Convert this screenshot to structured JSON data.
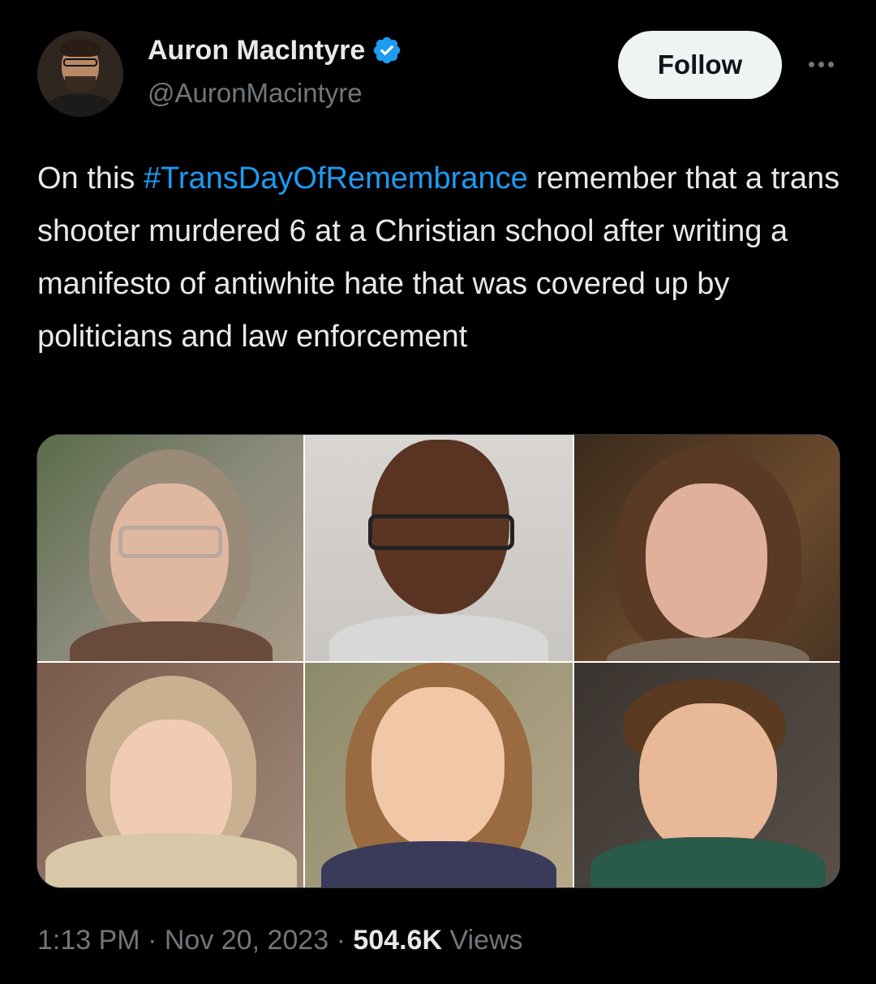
{
  "author": {
    "name": "Auron MacIntyre",
    "handle": "@AuronMacintyre",
    "avatar_icon": "user-avatar",
    "verified_icon": "verified-badge-icon",
    "verified_color": "#1d9bf0"
  },
  "actions": {
    "follow_label": "Follow",
    "more_icon": "more-options-icon"
  },
  "tweet": {
    "text_before": "On this ",
    "hashtag": "#TransDayOfRemembrance",
    "text_after": " remember that a trans shooter murdered 6 at a Christian school after writing a manifesto of antiwhite hate that was covered up by politicians and law enforcement",
    "hashtag_color": "#1d9bf0"
  },
  "media": {
    "layout": "3x2 photo grid",
    "photo_count": 6
  },
  "meta": {
    "time": "1:13 PM",
    "separator": "·",
    "date": "Nov 20, 2023",
    "views_count": "504.6K",
    "views_label": "Views"
  },
  "colors": {
    "background": "#000000",
    "text_primary": "#e7e9ea",
    "text_secondary": "#71767b",
    "accent": "#1d9bf0",
    "follow_button_bg": "#eff3f4"
  }
}
